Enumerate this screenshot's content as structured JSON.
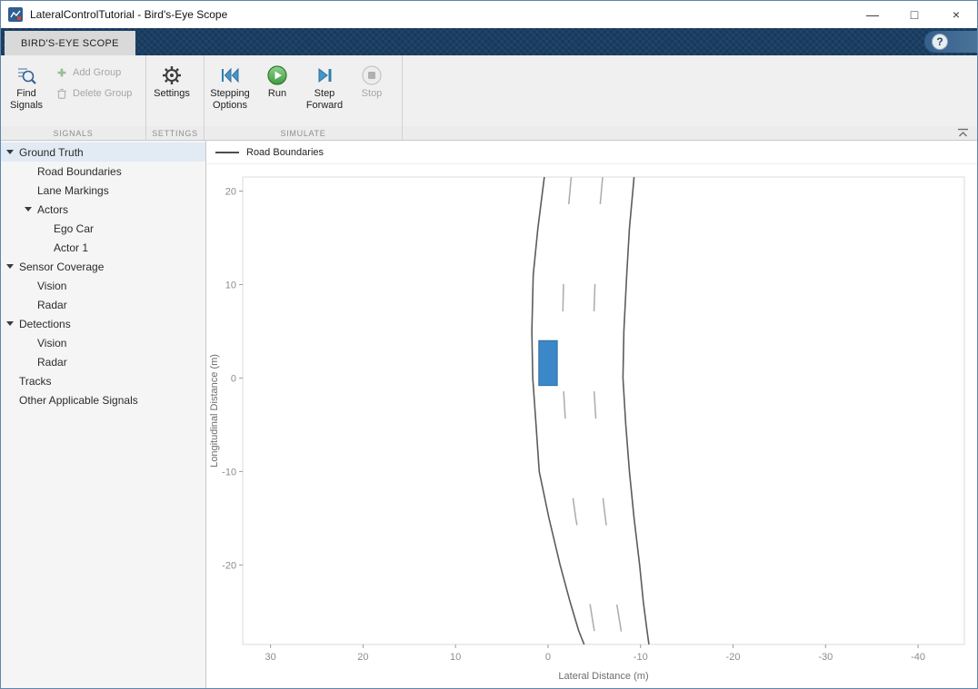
{
  "window": {
    "title": "LateralControlTutorial - Bird's-Eye Scope",
    "controls": {
      "minimize": "—",
      "maximize": "□",
      "close": "×"
    }
  },
  "tabstrip": {
    "tab": "BIRD'S-EYE SCOPE",
    "help": "?"
  },
  "toolbar": {
    "sections": [
      "SIGNALS",
      "SETTINGS",
      "SIMULATE"
    ],
    "find_signals": {
      "l1": "Find",
      "l2": "Signals"
    },
    "add_group": "Add Group",
    "delete_group": "Delete Group",
    "settings": {
      "l1": "Settings",
      "l2": ""
    },
    "stepping_options": {
      "l1": "Stepping",
      "l2": "Options"
    },
    "run": {
      "l1": "Run",
      "l2": ""
    },
    "step_forward": {
      "l1": "Step",
      "l2": "Forward"
    },
    "stop": {
      "l1": "Stop",
      "l2": ""
    },
    "icons": [
      "find-signals-icon",
      "add-group-icon",
      "delete-group-icon",
      "gear-icon",
      "stepping-options-icon",
      "run-icon",
      "step-forward-icon",
      "stop-icon",
      "collapse-toolstrip-icon"
    ]
  },
  "tree": {
    "items": [
      {
        "label": "Ground Truth",
        "level": 0,
        "expanded": true
      },
      {
        "label": "Road Boundaries",
        "level": 1
      },
      {
        "label": "Lane Markings",
        "level": 1
      },
      {
        "label": "Actors",
        "level": 1,
        "expanded": true
      },
      {
        "label": "Ego Car",
        "level": 2
      },
      {
        "label": "Actor 1",
        "level": 2
      },
      {
        "label": "Sensor Coverage",
        "level": 0,
        "expanded": true
      },
      {
        "label": "Vision",
        "level": 1
      },
      {
        "label": "Radar",
        "level": 1
      },
      {
        "label": "Detections",
        "level": 0,
        "expanded": true
      },
      {
        "label": "Vision",
        "level": 1
      },
      {
        "label": "Radar",
        "level": 1
      },
      {
        "label": "Tracks",
        "level": 0
      },
      {
        "label": "Other Applicable Signals",
        "level": 0
      }
    ]
  },
  "chart_data": {
    "type": "line",
    "title": "",
    "xlabel": "Lateral Distance (m)",
    "ylabel": "Longitudinal Distance (m)",
    "xlim": [
      33,
      -45
    ],
    "ylim": [
      -28.5,
      21.5
    ],
    "x_reversed": true,
    "grid": false,
    "x_ticks": [
      30,
      20,
      10,
      0,
      -10,
      -20,
      -30,
      -40
    ],
    "y_ticks": [
      20,
      10,
      0,
      -10,
      -20
    ],
    "legend": [
      {
        "label": "Road Boundaries",
        "color": "#4d4d4d",
        "type": "line",
        "position": "top-left"
      }
    ],
    "road_boundaries": {
      "color": "#5c5c5c",
      "width": 1.6,
      "left": [
        [
          0.4,
          21.5
        ],
        [
          1.1,
          16
        ],
        [
          1.6,
          11
        ],
        [
          1.75,
          5
        ],
        [
          1.65,
          0
        ],
        [
          1.3,
          -5
        ],
        [
          0.95,
          -10
        ],
        [
          -0.1,
          -15
        ],
        [
          -1.3,
          -20
        ],
        [
          -2.4,
          -24
        ],
        [
          -3.3,
          -27
        ],
        [
          -3.9,
          -28.5
        ]
      ],
      "right": [
        [
          -9.3,
          21.5
        ],
        [
          -8.8,
          16
        ],
        [
          -8.5,
          11
        ],
        [
          -8.2,
          5
        ],
        [
          -8.1,
          0
        ],
        [
          -8.4,
          -5
        ],
        [
          -8.8,
          -10
        ],
        [
          -9.3,
          -15
        ],
        [
          -9.9,
          -20
        ],
        [
          -10.3,
          -24
        ],
        [
          -10.7,
          -27
        ],
        [
          -10.9,
          -28.5
        ]
      ]
    },
    "lane_markings": {
      "color": "#ababab",
      "width": 1.5,
      "dash": [
        30,
        88
      ],
      "lines": [
        [
          [
            -2.5,
            21.5
          ],
          [
            -2.0,
            16
          ],
          [
            -1.7,
            11
          ],
          [
            -1.55,
            5
          ],
          [
            -1.6,
            0
          ],
          [
            -1.9,
            -5
          ],
          [
            -2.3,
            -10
          ],
          [
            -3.0,
            -15
          ],
          [
            -3.9,
            -20
          ],
          [
            -4.5,
            -24
          ],
          [
            -5.0,
            -27
          ],
          [
            -5.3,
            -28.5
          ]
        ],
        [
          [
            -5.9,
            21.5
          ],
          [
            -5.4,
            16
          ],
          [
            -5.1,
            11
          ],
          [
            -4.9,
            5
          ],
          [
            -4.9,
            0
          ],
          [
            -5.2,
            -5
          ],
          [
            -5.6,
            -10
          ],
          [
            -6.2,
            -15
          ],
          [
            -6.9,
            -20
          ],
          [
            -7.4,
            -24
          ],
          [
            -7.9,
            -27
          ],
          [
            -8.1,
            -28.5
          ]
        ]
      ]
    },
    "actors": [
      {
        "name": "ego-car",
        "color": "#3b87c8",
        "border": "#2f6ea8",
        "lat": [
          1.0,
          -1.0
        ],
        "long": [
          4.0,
          -0.8
        ]
      }
    ]
  }
}
